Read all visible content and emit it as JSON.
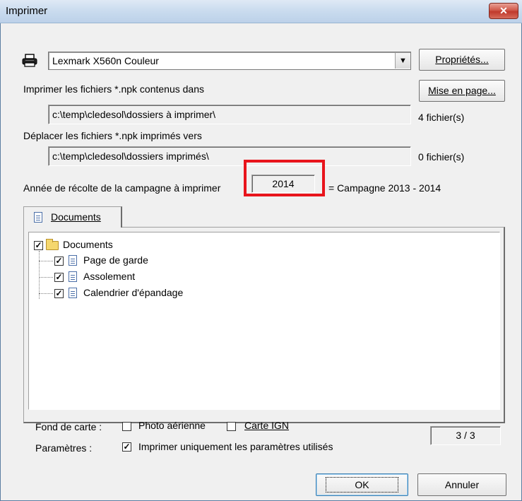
{
  "window": {
    "title": "Imprimer",
    "close_glyph": "✕"
  },
  "printer": {
    "icon": "printer-icon",
    "selected": "Lexmark X560n Couleur",
    "properties_label": "Propriétés...",
    "page_setup_label": "Mise en page..."
  },
  "source": {
    "label": "Imprimer les fichiers *.npk contenus dans",
    "path": "c:\\temp\\cledesol\\dossiers à imprimer\\",
    "count": "4 fichier(s)"
  },
  "destination": {
    "label": "Déplacer les fichiers *.npk imprimés vers",
    "path": "c:\\temp\\cledesol\\dossiers imprimés\\",
    "count": "0 fichier(s)"
  },
  "year": {
    "label": "Année de récolte de la campagne à imprimer",
    "value": "2014",
    "campaign": "= Campagne 2013 - 2014"
  },
  "tabs": [
    {
      "label": "Documents"
    }
  ],
  "tree": {
    "root": {
      "label": "Documents",
      "checked": true
    },
    "children": [
      {
        "label": "Page de garde",
        "checked": true
      },
      {
        "label": "Assolement",
        "checked": true
      },
      {
        "label": "Calendrier d'épandage",
        "checked": true
      }
    ]
  },
  "map_background": {
    "label": "Fond de carte :",
    "options": [
      {
        "label": "Photo aérienne",
        "checked": false
      },
      {
        "label": "Carte IGN",
        "checked": false
      }
    ]
  },
  "parameters": {
    "label": "Paramètres :",
    "option": {
      "label": "Imprimer uniquement les paramètres utilisés",
      "checked": true
    }
  },
  "page_counter": "3 / 3",
  "buttons": {
    "ok": "OK",
    "cancel": "Annuler"
  }
}
